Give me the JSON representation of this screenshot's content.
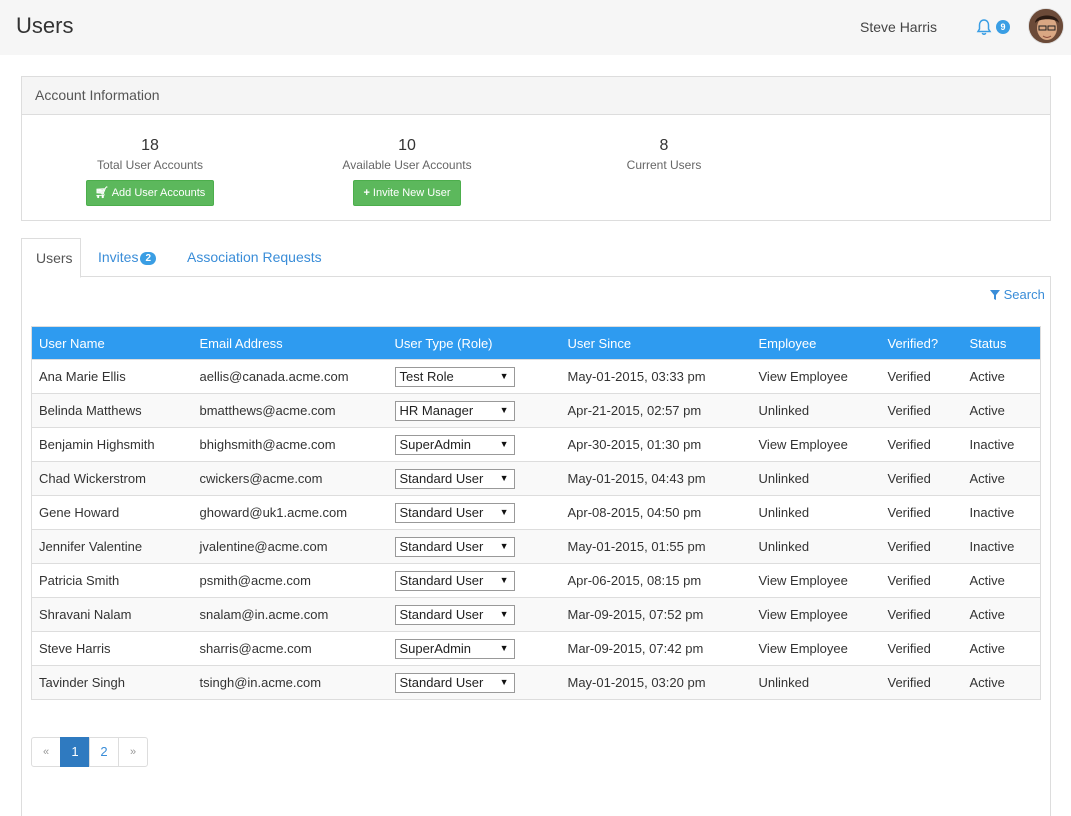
{
  "header": {
    "title": "Users",
    "user_name": "Steve Harris",
    "notification_count": "9"
  },
  "account": {
    "heading": "Account Information",
    "stats": [
      {
        "value": "18",
        "label": "Total User Accounts"
      },
      {
        "value": "10",
        "label": "Available User Accounts"
      },
      {
        "value": "8",
        "label": "Current Users"
      }
    ],
    "add_button": "Add User Accounts",
    "invite_button": "Invite New User"
  },
  "tabs": [
    {
      "label": "Users"
    },
    {
      "label": "Invites",
      "badge": "2"
    },
    {
      "label": "Association Requests"
    }
  ],
  "search_label": "Search",
  "table": {
    "columns": [
      "User Name",
      "Email Address",
      "User Type (Role)",
      "User Since",
      "Employee",
      "Verified?",
      "Status"
    ],
    "rows": [
      {
        "name": "Ana Marie Ellis",
        "email": "aellis@canada.acme.com",
        "role": "Test Role",
        "since": "May-01-2015, 03:33 pm",
        "employee": "View Employee",
        "verified": "Verified",
        "status": "Active"
      },
      {
        "name": "Belinda Matthews",
        "email": "bmatthews@acme.com",
        "role": "HR Manager",
        "since": "Apr-21-2015, 02:57 pm",
        "employee": "Unlinked",
        "verified": "Verified",
        "status": "Active"
      },
      {
        "name": "Benjamin Highsmith",
        "email": "bhighsmith@acme.com",
        "role": "SuperAdmin",
        "since": "Apr-30-2015, 01:30 pm",
        "employee": "View Employee",
        "verified": "Verified",
        "status": "Inactive"
      },
      {
        "name": "Chad Wickerstrom",
        "email": "cwickers@acme.com",
        "role": "Standard User",
        "since": "May-01-2015, 04:43 pm",
        "employee": "Unlinked",
        "verified": "Verified",
        "status": "Active"
      },
      {
        "name": "Gene Howard",
        "email": "ghoward@uk1.acme.com",
        "role": "Standard User",
        "since": "Apr-08-2015, 04:50 pm",
        "employee": "Unlinked",
        "verified": "Verified",
        "status": "Inactive"
      },
      {
        "name": "Jennifer Valentine",
        "email": "jvalentine@acme.com",
        "role": "Standard User",
        "since": "May-01-2015, 01:55 pm",
        "employee": "Unlinked",
        "verified": "Verified",
        "status": "Inactive"
      },
      {
        "name": "Patricia Smith",
        "email": "psmith@acme.com",
        "role": "Standard User",
        "since": "Apr-06-2015, 08:15 pm",
        "employee": "View Employee",
        "verified": "Verified",
        "status": "Active"
      },
      {
        "name": "Shravani Nalam",
        "email": "snalam@in.acme.com",
        "role": "Standard User",
        "since": "Mar-09-2015, 07:52 pm",
        "employee": "View Employee",
        "verified": "Verified",
        "status": "Active"
      },
      {
        "name": "Steve Harris",
        "email": "sharris@acme.com",
        "role": "SuperAdmin",
        "since": "Mar-09-2015, 07:42 pm",
        "employee": "View Employee",
        "verified": "Verified",
        "status": "Active"
      },
      {
        "name": "Tavinder Singh",
        "email": "tsingh@in.acme.com",
        "role": "Standard User",
        "since": "May-01-2015, 03:20 pm",
        "employee": "Unlinked",
        "verified": "Verified",
        "status": "Active"
      }
    ]
  },
  "pagination": {
    "prev": "«",
    "pages": [
      "1",
      "2"
    ],
    "next": "»",
    "current": "1"
  }
}
